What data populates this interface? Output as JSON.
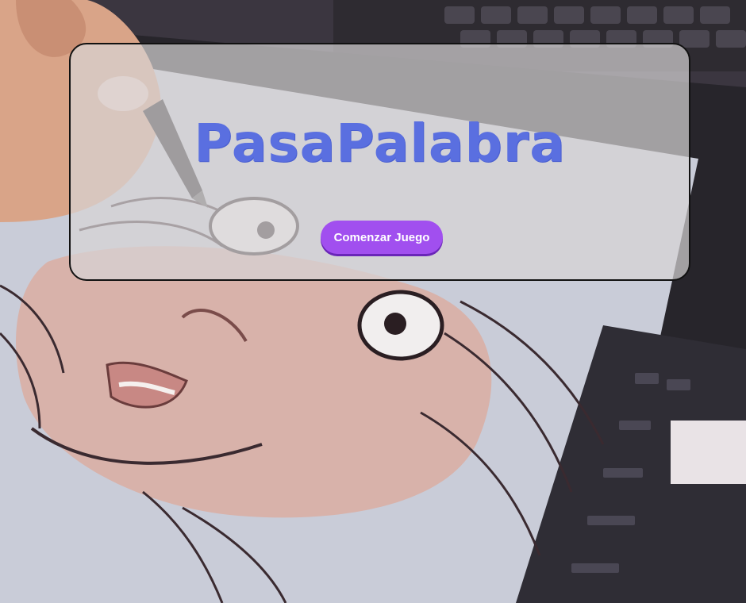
{
  "app": {
    "title": "PasaPalabra",
    "start_button_label": "Comenzar Juego"
  },
  "colors": {
    "title": "#5a6fe0",
    "button": "#a14fef",
    "card_background": "rgba(215,212,214,0.70)"
  },
  "background": {
    "icon": "drawing-tablet-illustration"
  }
}
